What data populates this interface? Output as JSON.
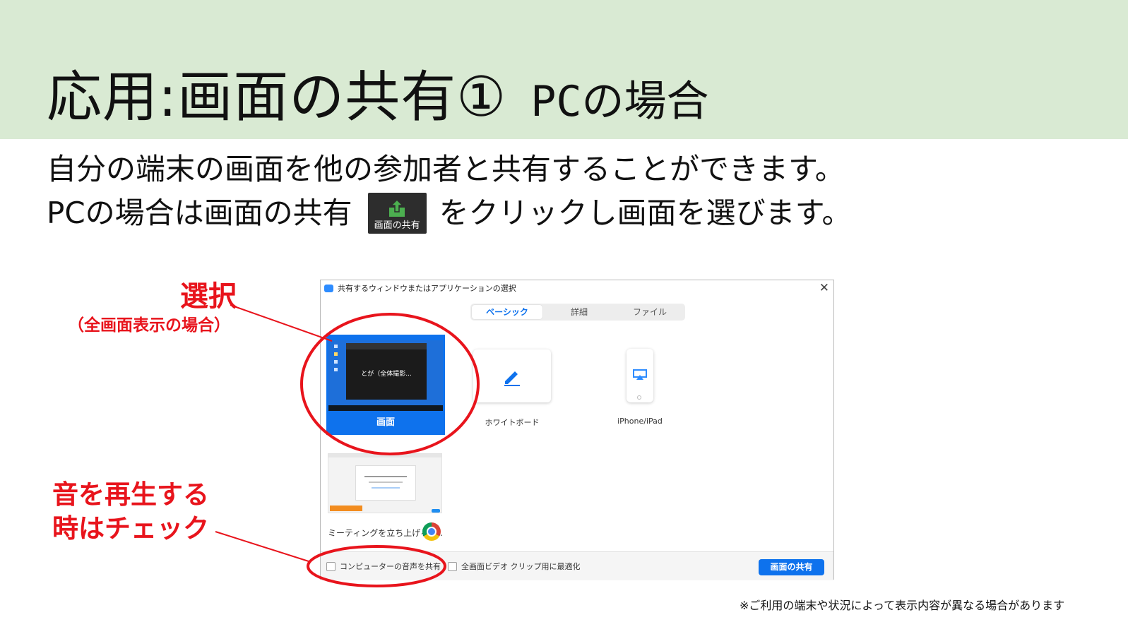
{
  "slide": {
    "title_main": "応用:画面の共有①",
    "title_sub": "PCの場合",
    "line1": "自分の端末の画面を他の参加者と共有することができます。",
    "line2_prefix": "PCの場合は画面の共有",
    "line2_suffix": "をクリックし画面を選びます。",
    "inline_button_label": "画面の共有",
    "note": "※ご利用の端末や状況によって表示内容が異なる場合があります"
  },
  "callouts": {
    "select": "選択",
    "select_sub": "（全画面表示の場合）",
    "sound_line1": "音を再生する",
    "sound_line2": "時はチェック"
  },
  "dialog": {
    "title": "共有するウィンドウまたはアプリケーションの選択",
    "close": "✕",
    "tabs": [
      "ベーシック",
      "詳細",
      "ファイル"
    ],
    "active_tab": "ベーシック",
    "tiles": {
      "screen": "画面",
      "screen_preview_text": "とが（全体撮影...",
      "whiteboard": "ホワイトボード",
      "iphone": "iPhone/iPad",
      "browser": "ミーティングを立ち上げる -..."
    },
    "footer": {
      "audio_checkbox": "コンピューターの音声を共有",
      "video_checkbox": "全画面ビデオ クリップ用に最適化",
      "share_button": "画面の共有"
    }
  },
  "colors": {
    "banner": "#d9ead3",
    "callout_red": "#e8141c",
    "zoom_blue": "#0e72ed",
    "icon_green": "#4caf50"
  },
  "icons": [
    "share-screen-icon",
    "pencil-icon",
    "airplay-icon",
    "chrome-icon",
    "close-icon",
    "zoom-logo-icon"
  ]
}
